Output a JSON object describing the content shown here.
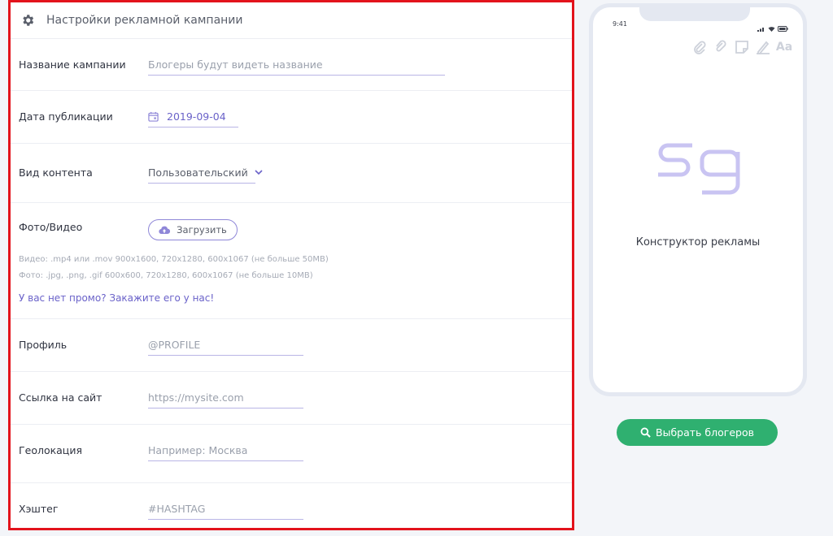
{
  "header": {
    "title": "Настройки рекламной кампании"
  },
  "fields": {
    "campaign_name": {
      "label": "Название кампании",
      "placeholder": "Блогеры будут видеть название"
    },
    "publish_date": {
      "label": "Дата публикации",
      "value": "2019-09-04"
    },
    "content_type": {
      "label": "Вид контента",
      "value": "Пользовательский"
    },
    "media": {
      "label": "Фото/Видео",
      "upload_label": "Загрузить",
      "video_hint": "Видео:  .mp4 или .mov 900x1600, 720x1280, 600x1067 (не больше 50MB)",
      "photo_hint": "Фото:     .jpg, .png, .gif 600x600, 720x1280, 600x1067 (не больше 10MB)",
      "promo_link": "У вас нет промо? Закажите его у нас!"
    },
    "profile": {
      "label": "Профиль",
      "placeholder": "@PROFILE"
    },
    "site_link": {
      "label": "Ссылка на сайт",
      "placeholder": "https://mysite.com"
    },
    "geolocation": {
      "label": "Геолокация",
      "placeholder": "Например: Москва"
    },
    "hashtag": {
      "label": "Хэштег",
      "placeholder": "#HASHTAG"
    }
  },
  "preview": {
    "time": "9:41",
    "tools": [
      "paperclip-icon",
      "link-icon",
      "sticker-icon",
      "pen-icon",
      "text-icon"
    ],
    "text_tool_label": "Aa",
    "logo": "Sg",
    "caption": "Конструктор рекламы"
  },
  "actions": {
    "choose_bloggers": "Выбрать блогеров"
  },
  "colors": {
    "accent": "#6a62c9",
    "green": "#2fb070",
    "highlight_border": "#e3131c",
    "logo": "#c9c4f2"
  }
}
